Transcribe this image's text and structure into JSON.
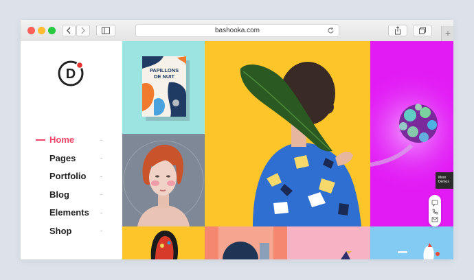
{
  "browser": {
    "url": "bashooka.com"
  },
  "sidebar": {
    "logo_letter": "D",
    "items": [
      {
        "label": "Home",
        "active": true
      },
      {
        "label": "Pages"
      },
      {
        "label": "Portfolio"
      },
      {
        "label": "Blog"
      },
      {
        "label": "Elements"
      },
      {
        "label": "Shop"
      }
    ],
    "expand_symbol": "-"
  },
  "book": {
    "title_line1": "PAPILLONS",
    "title_line2": "DE NUIT"
  },
  "widget": {
    "line1": "More",
    "line2": "Demos"
  },
  "colors": {
    "accent": "#ee4266",
    "yellow": "#fdc52a",
    "magenta": "#e21bf5",
    "teal": "#9ce4e2",
    "grey": "#7f8896",
    "salmon": "#f58770",
    "pink": "#f7b3c3",
    "sky": "#84cbf3"
  }
}
